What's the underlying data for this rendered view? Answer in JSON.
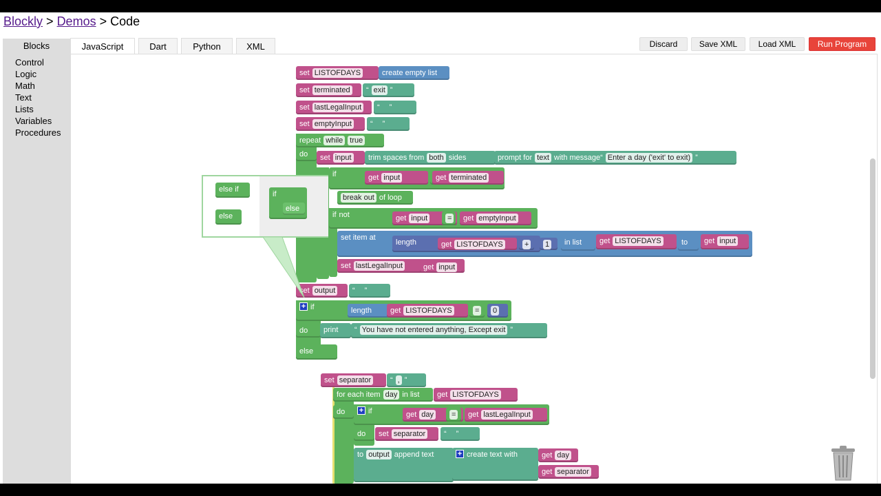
{
  "breadcrumb": {
    "items": [
      "Blockly",
      "Demos"
    ],
    "sep": ">",
    "current": "Code"
  },
  "toolbox": {
    "title": "Blocks",
    "categories": [
      "Control",
      "Logic",
      "Math",
      "Text",
      "Lists",
      "Variables",
      "Procedures"
    ]
  },
  "tabs": [
    "JavaScript",
    "Dart",
    "Python",
    "XML"
  ],
  "buttons": {
    "discard": "Discard",
    "save": "Save XML",
    "load": "Load XML",
    "run": "Run Program"
  },
  "colors": {
    "variables": "#c0518b",
    "loops": "#5cb25c",
    "text": "#5bad8f",
    "lists": "#5b8fc2",
    "math": "#5b6fb0",
    "run": "#e8443a"
  },
  "mutator": {
    "else_if": "else if",
    "else": "else",
    "if": "if",
    "if_else": "else"
  },
  "blocks": [
    {
      "c": "variables",
      "p": [
        [
          "l",
          "set"
        ],
        [
          "f",
          "LISTOFDAYS"
        ]
      ]
    },
    {
      "c": "lists",
      "p": [
        [
          "l",
          "create empty list"
        ]
      ]
    },
    {
      "c": "variables",
      "p": [
        [
          "l",
          "set"
        ],
        [
          "f",
          "terminated"
        ]
      ]
    },
    {
      "c": "text",
      "p": [
        [
          "l",
          "“"
        ],
        [
          "f",
          "exit"
        ],
        [
          "l",
          "”"
        ]
      ]
    },
    {
      "c": "variables",
      "p": [
        [
          "l",
          "set"
        ],
        [
          "f",
          "lastLegalInput"
        ]
      ]
    },
    {
      "c": "text",
      "p": [
        [
          "l",
          "“"
        ],
        [
          "f",
          " "
        ],
        [
          "l",
          "”"
        ]
      ]
    },
    {
      "c": "variables",
      "p": [
        [
          "l",
          "set"
        ],
        [
          "f",
          "emptyInput"
        ]
      ]
    },
    {
      "c": "text",
      "p": [
        [
          "l",
          "“"
        ],
        [
          "f",
          " "
        ],
        [
          "l",
          "”"
        ]
      ]
    },
    {
      "c": "loops",
      "p": [
        [
          "l",
          "repeat"
        ],
        [
          "f",
          "while"
        ],
        [
          "f",
          "true"
        ]
      ]
    },
    {
      "c": "loops",
      "p": [
        [
          "l",
          "do"
        ]
      ]
    },
    {
      "c": "variables",
      "p": [
        [
          "l",
          "set"
        ],
        [
          "f",
          "input"
        ]
      ]
    },
    {
      "c": "text",
      "p": [
        [
          "l",
          "trim spaces from"
        ],
        [
          "f",
          "both"
        ],
        [
          "l",
          "sides"
        ]
      ]
    },
    {
      "c": "text",
      "p": [
        [
          "l",
          "prompt for"
        ],
        [
          "f",
          "text"
        ],
        [
          "l",
          "with message“"
        ],
        [
          "f",
          "Enter a day ('exit' to exit)"
        ],
        [
          "l",
          "”"
        ]
      ]
    },
    {
      "c": "loops",
      "p": [
        [
          "l",
          "if"
        ]
      ]
    },
    {
      "c": "variables",
      "p": [
        [
          "l",
          "get"
        ],
        [
          "f",
          "input"
        ]
      ]
    },
    {
      "c": "loops",
      "p": [
        [
          "f",
          "="
        ]
      ]
    },
    {
      "c": "variables",
      "p": [
        [
          "l",
          "get"
        ],
        [
          "f",
          "terminated"
        ]
      ]
    },
    {
      "c": "loops",
      "p": [
        [
          "f",
          "break out"
        ],
        [
          "l",
          "of loop"
        ]
      ]
    },
    {
      "c": "loops",
      "p": [
        [
          "l",
          "if"
        ],
        [
          "l",
          "  not"
        ]
      ]
    },
    {
      "c": "variables",
      "p": [
        [
          "l",
          "get"
        ],
        [
          "f",
          "input"
        ]
      ]
    },
    {
      "c": "loops",
      "p": [
        [
          "f",
          "="
        ]
      ]
    },
    {
      "c": "variables",
      "p": [
        [
          "l",
          "get"
        ],
        [
          "f",
          "emptyInput"
        ]
      ]
    },
    {
      "c": "lists",
      "p": [
        [
          "l",
          "set item at"
        ]
      ]
    },
    {
      "c": "math",
      "p": [
        [
          "l",
          "length"
        ]
      ]
    },
    {
      "c": "variables",
      "p": [
        [
          "l",
          "get"
        ],
        [
          "f",
          "LISTOFDAYS"
        ]
      ]
    },
    {
      "c": "math",
      "p": [
        [
          "f",
          "+"
        ]
      ]
    },
    {
      "c": "math",
      "p": [
        [
          "f",
          "1"
        ]
      ]
    },
    {
      "c": "lists",
      "p": [
        [
          "l",
          "in list"
        ]
      ]
    },
    {
      "c": "variables",
      "p": [
        [
          "l",
          "get"
        ],
        [
          "f",
          "LISTOFDAYS"
        ]
      ]
    },
    {
      "c": "lists",
      "p": [
        [
          "l",
          "to"
        ]
      ]
    },
    {
      "c": "variables",
      "p": [
        [
          "l",
          "get"
        ],
        [
          "f",
          "input"
        ]
      ]
    },
    {
      "c": "variables",
      "p": [
        [
          "l",
          "set"
        ],
        [
          "f",
          "lastLegalInput"
        ]
      ]
    },
    {
      "c": "variables",
      "p": [
        [
          "l",
          "get"
        ],
        [
          "f",
          "input"
        ]
      ]
    },
    {
      "c": "variables",
      "p": [
        [
          "l",
          "set"
        ],
        [
          "f",
          "output"
        ]
      ]
    },
    {
      "c": "text",
      "p": [
        [
          "l",
          "“"
        ],
        [
          "f",
          " "
        ],
        [
          "l",
          "”"
        ]
      ]
    },
    {
      "c": "loops",
      "p": [
        [
          "p",
          "+"
        ],
        [
          "l",
          "if"
        ]
      ]
    },
    {
      "c": "lists",
      "p": [
        [
          "l",
          "length"
        ]
      ]
    },
    {
      "c": "variables",
      "p": [
        [
          "l",
          "get"
        ],
        [
          "f",
          "LISTOFDAYS"
        ]
      ]
    },
    {
      "c": "loops",
      "p": [
        [
          "f",
          "="
        ]
      ]
    },
    {
      "c": "math",
      "p": [
        [
          "f",
          "0"
        ]
      ]
    },
    {
      "c": "loops",
      "p": [
        [
          "l",
          "do"
        ]
      ]
    },
    {
      "c": "text",
      "p": [
        [
          "l",
          "print"
        ]
      ]
    },
    {
      "c": "text",
      "p": [
        [
          "l",
          "“"
        ],
        [
          "f",
          "You have not entered anything, Except exit"
        ],
        [
          "l",
          "”"
        ]
      ]
    },
    {
      "c": "loops",
      "p": [
        [
          "l",
          "else"
        ]
      ]
    },
    {
      "c": "variables",
      "p": [
        [
          "l",
          "set"
        ],
        [
          "f",
          "separator"
        ]
      ]
    },
    {
      "c": "text",
      "p": [
        [
          "l",
          "“"
        ],
        [
          "f",
          ","
        ],
        [
          "l",
          "”"
        ]
      ]
    },
    {
      "c": "loops",
      "p": [
        [
          "l",
          "for each item"
        ],
        [
          "f",
          "day"
        ],
        [
          "l",
          "in list"
        ]
      ]
    },
    {
      "c": "variables",
      "p": [
        [
          "l",
          "get"
        ],
        [
          "f",
          "LISTOFDAYS"
        ]
      ]
    },
    {
      "c": "loops",
      "p": [
        [
          "l",
          "do"
        ]
      ]
    },
    {
      "c": "loops",
      "p": [
        [
          "p",
          "+"
        ],
        [
          "l",
          "if"
        ]
      ]
    },
    {
      "c": "variables",
      "p": [
        [
          "l",
          "get"
        ],
        [
          "f",
          "day"
        ]
      ]
    },
    {
      "c": "loops",
      "p": [
        [
          "f",
          "="
        ]
      ]
    },
    {
      "c": "variables",
      "p": [
        [
          "l",
          "get"
        ],
        [
          "f",
          "lastLegalInput"
        ]
      ]
    },
    {
      "c": "loops",
      "p": [
        [
          "l",
          "do"
        ]
      ]
    },
    {
      "c": "variables",
      "p": [
        [
          "l",
          "set"
        ],
        [
          "f",
          "separator"
        ]
      ]
    },
    {
      "c": "text",
      "p": [
        [
          "l",
          "“"
        ],
        [
          "f",
          " "
        ],
        [
          "l",
          "”"
        ]
      ]
    },
    {
      "c": "text",
      "p": [
        [
          "l",
          "to"
        ],
        [
          "f",
          "output"
        ],
        [
          "l",
          "append text"
        ]
      ]
    },
    {
      "c": "text",
      "p": [
        [
          "p",
          "+"
        ],
        [
          "l",
          "create text with"
        ]
      ]
    },
    {
      "c": "variables",
      "p": [
        [
          "l",
          "get"
        ],
        [
          "f",
          "day"
        ]
      ]
    },
    {
      "c": "variables",
      "p": [
        [
          "l",
          "get"
        ],
        [
          "f",
          "separator"
        ]
      ]
    }
  ]
}
